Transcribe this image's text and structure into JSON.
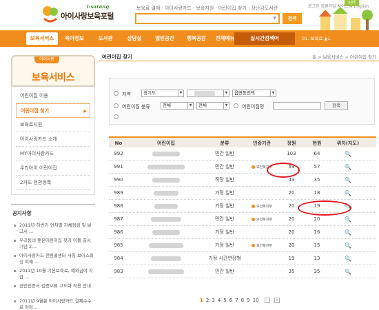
{
  "header": {
    "logo_sub": "i-sarang",
    "logo_title": "아이사랑보육포털",
    "search_links": "보육료 결제 · 아이사랑카드 · 보육지원 · 어린이집 찾기 · 장난감도서관",
    "search_button": "검색",
    "top_links": "로그인  회원가입  사이트맵  English",
    "location_tab": "지역"
  },
  "nav": {
    "items": [
      {
        "label": "보육서비스",
        "active": true
      },
      {
        "label": "육아정보",
        "active": false
      },
      {
        "label": "도서관",
        "active": false
      },
      {
        "label": "상담실",
        "active": false
      },
      {
        "label": "열린공간",
        "active": false
      },
      {
        "label": "행복공감",
        "active": false
      },
      {
        "label": "전체메뉴 ▾",
        "active": false
      }
    ],
    "live_search": "실시간검색어",
    "rank": "01. 보육료  ▲1"
  },
  "sidebar": {
    "pill": "아이사랑",
    "title": "보육서비스",
    "items": [
      {
        "label": "어린이집 이용",
        "active": false
      },
      {
        "label": "어린이집 찾기",
        "active": true
      },
      {
        "label": "보육료지원",
        "active": false
      },
      {
        "label": "아이사랑카드 소개",
        "active": false
      },
      {
        "label": "MY아이사랑카드",
        "active": false
      },
      {
        "label": "우리아이 어린이집",
        "active": false
      },
      {
        "label": "2카드 전환등록",
        "active": false
      }
    ]
  },
  "notice": {
    "title": "공지사항",
    "items": [
      "2011년 하반기 연차별 자체점검 및 보고서 ...",
      "우리동네 좋은어린이집 찾기 어플 출시 기념 2...",
      "아이사랑카드 전환콜센터 사칭 보이스피싱 피해 ...",
      "2011년 10월 기본보육료, 예외급여 지급 ...",
      "공인인증서 검증오류 고도화 작용 안내",
      "2011년 9월분 아이사랑카드 결제수수료 어린..."
    ]
  },
  "main": {
    "title": "어린이집 찾기",
    "breadcrumb": "홈 > 보육서비스 > 어린이집 찾기",
    "filter": {
      "region_label": "지역",
      "region_value": "경기도",
      "town_value": "읍면동전택",
      "type_label": "어린이집 분류",
      "type_value1": "전체",
      "type_value2": "전체",
      "name_label": "어린이집명",
      "search_button": "검색"
    },
    "columns": [
      "No",
      "어린이집",
      "분류",
      "인증기관",
      "정원",
      "현원",
      "위치(지도)"
    ],
    "rows": [
      {
        "no": "992",
        "name_w": 40,
        "type": "민간 일반",
        "cert": "",
        "cap": "103",
        "cur": "64"
      },
      {
        "no": "991",
        "name_w": 54,
        "type": "민간 일반",
        "cert": "보건복지부",
        "cap": "69",
        "cur": "57"
      },
      {
        "no": "990",
        "name_w": 40,
        "type": "직장 일반",
        "cert": "",
        "cap": "43",
        "cur": "35"
      },
      {
        "no": "989",
        "name_w": 36,
        "type": "가정 일반",
        "cert": "",
        "cap": "20",
        "cur": "18"
      },
      {
        "no": "988",
        "name_w": 34,
        "type": "가정 일반",
        "cert": "보건복지부",
        "cap": "20",
        "cur": "19"
      },
      {
        "no": "987",
        "name_w": 44,
        "type": "민간 일반",
        "cert": "보건복지부",
        "cap": "20",
        "cur": "20"
      },
      {
        "no": "986",
        "name_w": 40,
        "type": "가정 일반",
        "cert": "",
        "cap": "20",
        "cur": "16"
      },
      {
        "no": "985",
        "name_w": 50,
        "type": "가정 일반",
        "cert": "보건복지부",
        "cap": "20",
        "cur": "15"
      },
      {
        "no": "984",
        "name_w": 44,
        "type": "가정 시간연장형",
        "cert": "",
        "cap": "19",
        "cur": "13"
      },
      {
        "no": "983",
        "name_w": 52,
        "type": "민간 일반",
        "cert": "",
        "cap": "35",
        "cur": "35"
      }
    ],
    "pages": [
      "1",
      "2",
      "3",
      "4",
      "5",
      "6",
      "7",
      "8",
      "9",
      "10"
    ]
  }
}
